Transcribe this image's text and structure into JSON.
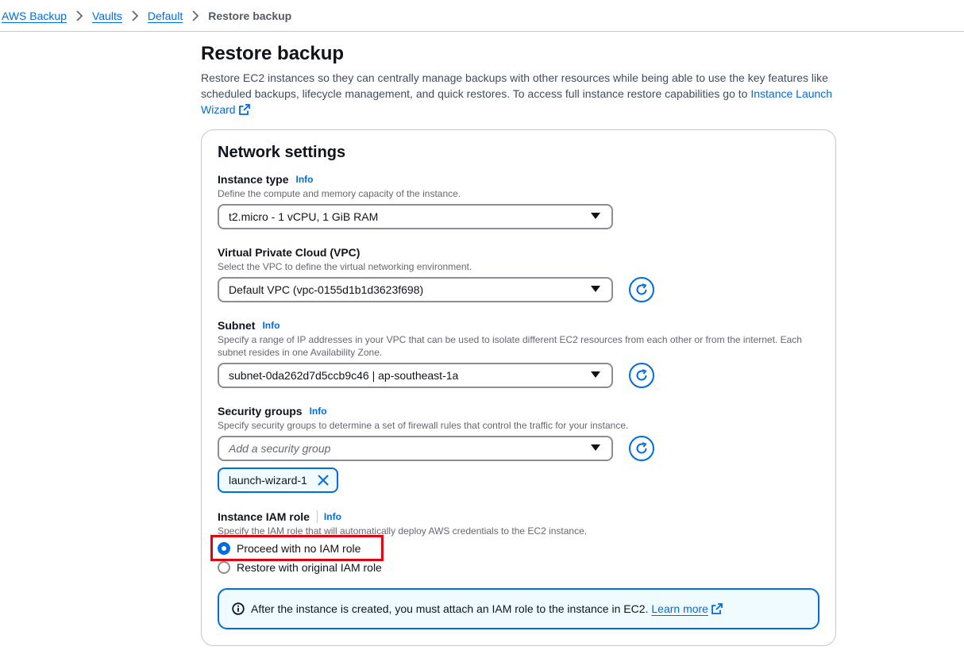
{
  "breadcrumb": {
    "items": [
      "AWS Backup",
      "Vaults",
      "Default"
    ],
    "current": "Restore backup"
  },
  "page": {
    "title": "Restore backup",
    "description_pre": "Restore EC2 instances so they can centrally manage backups with other resources while being able to use the key features like scheduled backups, lifecycle management, and quick restores. To access full instance restore capabilities go to ",
    "description_link": "Instance Launch Wizard"
  },
  "network_settings": {
    "title": "Network settings",
    "info_label": "Info",
    "instance_type": {
      "label": "Instance type",
      "description": "Define the compute and memory capacity of the instance.",
      "value": "t2.micro - 1 vCPU, 1 GiB RAM"
    },
    "vpc": {
      "label": "Virtual Private Cloud (VPC)",
      "description": "Select the VPC to define the virtual networking environment.",
      "value": "Default VPC (vpc-0155d1b1d3623f698)"
    },
    "subnet": {
      "label": "Subnet",
      "description": "Specify a range of IP addresses in your VPC that can be used to isolate different EC2 resources from each other or from the internet. Each subnet resides in one Availability Zone.",
      "value": "subnet-0da262d7d5ccb9c46 | ap-southeast-1a"
    },
    "security_groups": {
      "label": "Security groups",
      "description": "Specify security groups to determine a set of firewall rules that control the traffic for your instance.",
      "placeholder": "Add a security group",
      "tokens": [
        "launch-wizard-1"
      ]
    },
    "iam_role": {
      "label": "Instance IAM role",
      "description": "Specify the IAM role that will automatically deploy AWS credentials to the EC2 instance.",
      "options": [
        {
          "label": "Proceed with no IAM role",
          "selected": true
        },
        {
          "label": "Restore with original IAM role",
          "selected": false
        }
      ]
    },
    "alert": {
      "text": "After the instance is created, you must attach an IAM role to the instance in EC2.",
      "link": "Learn more"
    }
  },
  "colors": {
    "link": "#006ce0",
    "highlight": "#e0000f",
    "alert_bg": "#f0fbff"
  }
}
